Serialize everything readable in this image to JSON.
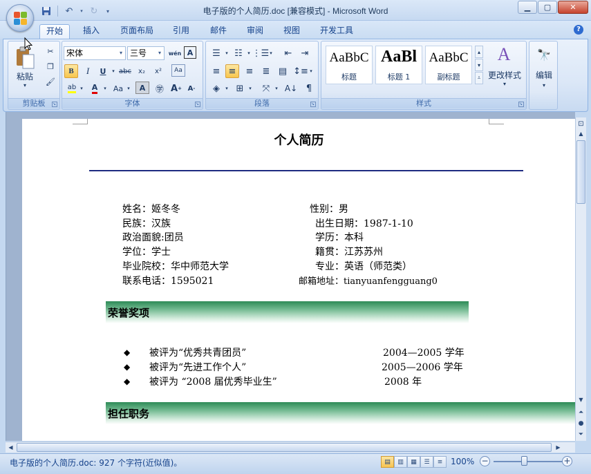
{
  "window": {
    "title": "电子版的个人简历.doc [兼容模式] - Microsoft Word",
    "controls": [
      "minimize",
      "maximize",
      "close"
    ]
  },
  "quick_access": [
    "save-icon",
    "undo-icon",
    "redo-icon",
    "customize-icon"
  ],
  "tabs": [
    {
      "label": "开始",
      "active": true
    },
    {
      "label": "插入"
    },
    {
      "label": "页面布局"
    },
    {
      "label": "引用"
    },
    {
      "label": "邮件"
    },
    {
      "label": "审阅"
    },
    {
      "label": "视图"
    },
    {
      "label": "开发工具"
    }
  ],
  "ribbon": {
    "clipboard": {
      "paste_label": "粘贴",
      "group_label": "剪贴板"
    },
    "font": {
      "font_name": "宋体",
      "font_size": "三号",
      "group_label": "字体"
    },
    "paragraph": {
      "group_label": "段落"
    },
    "styles": {
      "group_label": "样式",
      "items": [
        {
          "sample": "AaBbC",
          "label": "标题"
        },
        {
          "sample": "AaBl",
          "label": "标题 1"
        },
        {
          "sample": "AaBbC",
          "label": "副标题"
        }
      ],
      "change_styles_label": "更改样式"
    },
    "editing": {
      "label": "编辑"
    }
  },
  "document": {
    "title": "个人简历",
    "info_left": [
      "姓名：姬冬冬",
      "民族：汉族",
      "政治面貌:团员",
      "学位：学士",
      "毕业院校：华中师范大学",
      "联系电话：1595021"
    ],
    "info_right": [
      "性别：男",
      "出生日期：1987-1-10",
      "学历：本科",
      "籍贯：江苏苏州",
      "专业：英语（师范类）",
      "邮箱地址：tianyuanfengguang0"
    ],
    "honors_heading": "荣誉奖项",
    "honors": [
      {
        "text": "被评为“优秀共青团员”",
        "years": "2004—2005 学年"
      },
      {
        "text": "被评为“先进工作个人”",
        "years": "2005—2006 学年"
      },
      {
        "text": "被评为 “2008 届优秀毕业生”",
        "years": "2008 年"
      }
    ],
    "positions_heading": "担任职务",
    "section_color": "#2e8b57",
    "rule_color": "#1d2a80"
  },
  "status": {
    "text": "电子版的个人简历.doc: 927 个字符(近似值)。",
    "zoom": "100%"
  }
}
